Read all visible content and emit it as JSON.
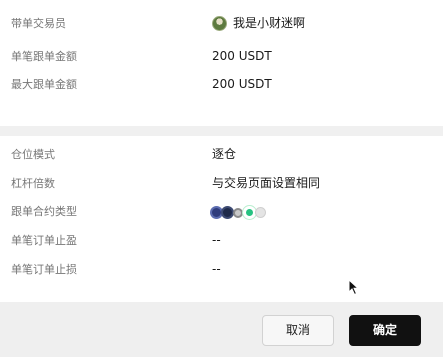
{
  "copy_settings": {
    "trader": {
      "label": "带单交易员",
      "name": "我是小财迷啊",
      "avatar_icon": "trader-avatar"
    },
    "single_amount": {
      "label": "单笔跟单金额",
      "value": "200 USDT"
    },
    "max_amount": {
      "label": "最大跟单金额",
      "value": "200 USDT"
    },
    "margin_mode": {
      "label": "仓位模式",
      "value": "逐仓"
    },
    "leverage": {
      "label": "杠杆倍数",
      "value": "与交易页面设置相同"
    },
    "contract_types": {
      "label": "跟单合约类型",
      "coins": [
        "coin-icon",
        "coin-icon",
        "coin-icon",
        "coin-icon",
        "coin-icon"
      ],
      "coin_colors": [
        "#2f3c7c",
        "#1f2a4a",
        "#8a8a8a",
        "#26c281",
        "#e4e4e4"
      ]
    },
    "take_profit": {
      "label": "单笔订单止盈",
      "value": "--"
    },
    "stop_loss": {
      "label": "单笔订单止损",
      "value": "--"
    }
  },
  "footer": {
    "cancel_label": "取消",
    "confirm_label": "确定"
  },
  "colors": {
    "accent": "#111111",
    "label_text": "#767676",
    "value_text": "#1a1a1a",
    "background": "#ffffff"
  }
}
